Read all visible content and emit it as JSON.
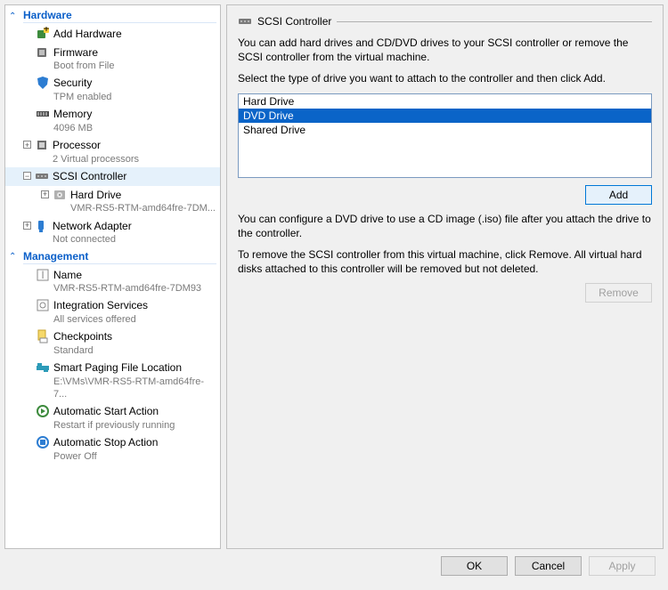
{
  "sections": {
    "hardware": "Hardware",
    "management": "Management"
  },
  "tree": {
    "addHardware": {
      "label": "Add Hardware"
    },
    "firmware": {
      "label": "Firmware",
      "sub": "Boot from File"
    },
    "security": {
      "label": "Security",
      "sub": "TPM enabled"
    },
    "memory": {
      "label": "Memory",
      "sub": "4096 MB"
    },
    "processor": {
      "label": "Processor",
      "sub": "2 Virtual processors"
    },
    "scsi": {
      "label": "SCSI Controller"
    },
    "hardDrive": {
      "label": "Hard Drive",
      "sub": "VMR-RS5-RTM-amd64fre-7DM..."
    },
    "network": {
      "label": "Network Adapter",
      "sub": "Not connected"
    },
    "name": {
      "label": "Name",
      "sub": "VMR-RS5-RTM-amd64fre-7DM93"
    },
    "integration": {
      "label": "Integration Services",
      "sub": "All services offered"
    },
    "checkpoints": {
      "label": "Checkpoints",
      "sub": "Standard"
    },
    "paging": {
      "label": "Smart Paging File Location",
      "sub": "E:\\VMs\\VMR-RS5-RTM-amd64fre-7..."
    },
    "autoStart": {
      "label": "Automatic Start Action",
      "sub": "Restart if previously running"
    },
    "autoStop": {
      "label": "Automatic Stop Action",
      "sub": "Power Off"
    }
  },
  "right": {
    "title": "SCSI Controller",
    "intro": "You can add hard drives and CD/DVD drives to your SCSI controller or remove the SCSI controller from the virtual machine.",
    "selectPrompt": "Select the type of drive you want to attach to the controller and then click Add.",
    "driveTypes": [
      "Hard Drive",
      "DVD Drive",
      "Shared Drive"
    ],
    "selectedDriveIndex": 1,
    "addLabel": "Add",
    "dvdNote": "You can configure a DVD drive to use a CD image (.iso) file after you attach the drive to the controller.",
    "removeNote": "To remove the SCSI controller from this virtual machine, click Remove. All virtual hard disks attached to this controller will be removed but not deleted.",
    "removeLabel": "Remove"
  },
  "footer": {
    "ok": "OK",
    "cancel": "Cancel",
    "apply": "Apply"
  }
}
